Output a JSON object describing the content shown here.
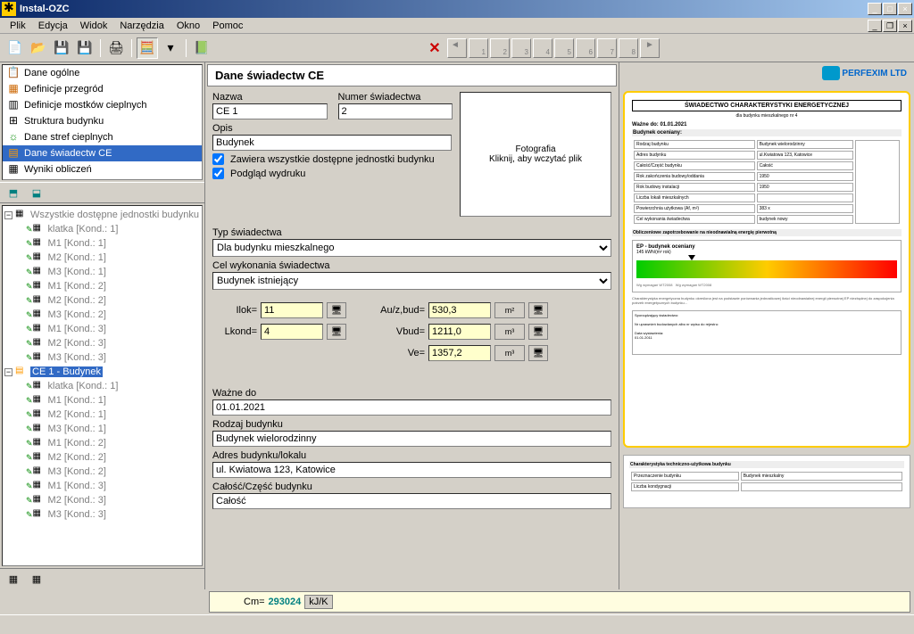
{
  "title": "Instal-OZC",
  "menu": {
    "plik": "Plik",
    "edycja": "Edycja",
    "widok": "Widok",
    "narzedzia": "Narzędzia",
    "okno": "Okno",
    "pomoc": "Pomoc"
  },
  "nav": {
    "ogolne": "Dane ogólne",
    "przegrod": "Definicje przegród",
    "mostkow": "Definicje mostków cieplnych",
    "struktura": "Struktura budynku",
    "stref": "Dane stref cieplnych",
    "swiadectw": "Dane świadectw CE",
    "wyniki": "Wyniki obliczeń"
  },
  "tree": {
    "root_gray": "Wszystkie dostępne jednostki budynku",
    "items": [
      "klatka [Kond.: 1]",
      "M1 [Kond.: 1]",
      "M2 [Kond.: 1]",
      "M3 [Kond.: 1]",
      "M1 [Kond.: 2]",
      "M2 [Kond.: 2]",
      "M3 [Kond.: 2]",
      "M1 [Kond.: 3]",
      "M2 [Kond.: 3]",
      "M3 [Kond.: 3]"
    ],
    "ce_node": "CE 1 - Budynek",
    "ce_items": [
      "klatka [Kond.: 1]",
      "M1 [Kond.: 1]",
      "M2 [Kond.: 1]",
      "M3 [Kond.: 1]",
      "M1 [Kond.: 2]",
      "M2 [Kond.: 2]",
      "M3 [Kond.: 2]",
      "M1 [Kond.: 3]",
      "M2 [Kond.: 3]",
      "M3 [Kond.: 3]"
    ]
  },
  "form": {
    "header": "Dane świadectw CE",
    "nazwa_label": "Nazwa",
    "nazwa": "CE 1",
    "numer_label": "Numer świadectwa",
    "numer": "2",
    "opis_label": "Opis",
    "opis": "Budynek",
    "photo_title": "Fotografia",
    "photo_hint": "Kliknij, aby wczytać plik",
    "chk_zawiera": "Zawiera wszystkie dostępne jednostki budynku",
    "chk_podglad": "Podgląd wydruku",
    "typ_label": "Typ świadectwa",
    "typ": "Dla budynku mieszkalnego",
    "cel_label": "Cel wykonania świadectwa",
    "cel": "Budynek istniejący",
    "ilok_label": "Ilok=",
    "ilok": "11",
    "lkond_label": "Lkond=",
    "lkond": "4",
    "auz_label": "Au/z,bud=",
    "auz": "530,3",
    "auz_unit": "m²",
    "vbud_label": "Vbud=",
    "vbud": "1211,0",
    "vbud_unit": "m³",
    "ve_label": "Ve=",
    "ve": "1357,2",
    "ve_unit": "m³",
    "wazne_label": "Ważne do",
    "wazne": "01.01.2021",
    "rodzaj_label": "Rodzaj budynku",
    "rodzaj": "Budynek wielorodzinny",
    "adres_label": "Adres budynku/lokalu",
    "adres": "ul. Kwiatowa 123, Katowice",
    "calosc_label": "Całość/Część budynku",
    "calosc": "Całość"
  },
  "footer": {
    "cm_label": "Cm=",
    "cm_val": "293024",
    "cm_unit": "kJ/K"
  },
  "cert": {
    "title": "ŚWIADECTWO CHARAKTERYSTYKI ENERGETYCZNEJ",
    "sub": "dla budynku mieszkalnego nr 4",
    "wazne": "Ważne do: 01.01.2021",
    "sec1": "Budynek oceniany:",
    "r1a": "Rodzaj budynku",
    "r1b": "Budynek wielorodzinny",
    "r2a": "Adres budynku",
    "r2b": "ul.Kwiatowa 123, Katowice",
    "r3a": "Całość/Część budynku",
    "r3b": "Całość",
    "r4a": "Rok zakończenia budowy/oddania",
    "r4b": "1950",
    "r5a": "Rok budowy instalacji",
    "r5b": "1950",
    "r6a": "Liczba lokali mieszkalnych",
    "r6b": "",
    "r7a": "Powierzchnia użytkowa (Af, m²)",
    "r7b": "383 x",
    "r8a": "Cel wykonania świadectwa",
    "r8b": "budynek nowy",
    "sec2": "Obliczeniowe zapotrzebowanie na nieodnawialną energię pierwotną",
    "ep": "EP - budynek oceniany",
    "ep_unit": "145 kWh/(m² rok)",
    "preview2_title": "Charakterystyka techniczno-użytkowa budynku"
  },
  "logo": "PERFEXIM LTD"
}
